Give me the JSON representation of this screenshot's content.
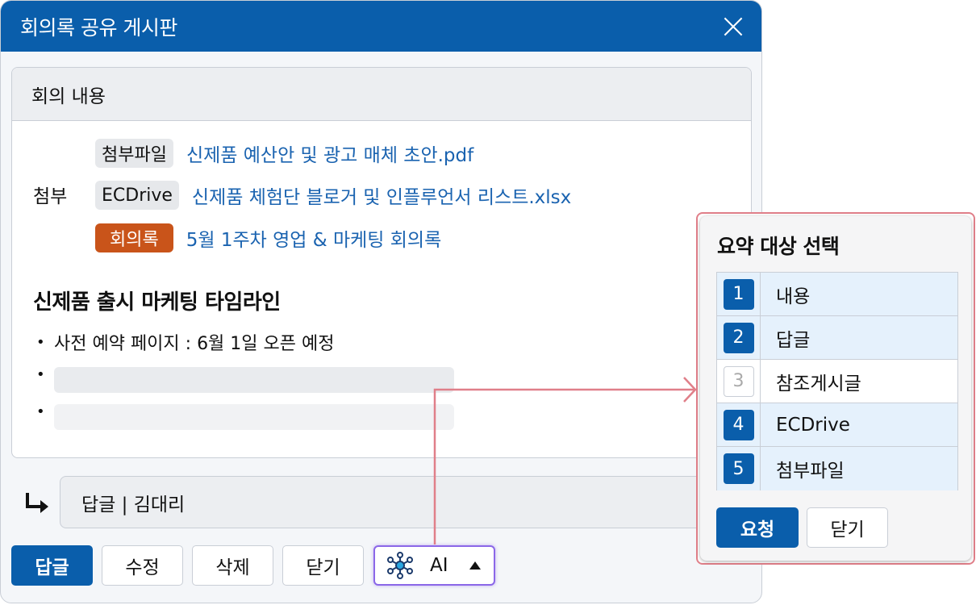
{
  "window": {
    "title": "회의록 공유 게시판"
  },
  "content": {
    "header": "회의 내용",
    "attach_label": "첨부",
    "attachments": [
      {
        "tag": "첨부파일",
        "file": "신제품 예산안 및 광고 매체 초안.pdf"
      },
      {
        "tag": "ECDrive",
        "file": "신제품 체험단 블로거 및 인플루언서 리스트.xlsx"
      },
      {
        "tag": "회의록",
        "file": "5월 1주차 영업 & 마케팅 회의록"
      }
    ],
    "section_title": "신제품 출시 마케팅 타임라인",
    "bullet": "•",
    "bullet_text": "사전 예약 페이지 : 6월 1일 오픈 예정"
  },
  "reply": {
    "text": "답글 | 김대리"
  },
  "buttons": {
    "reply": "답글",
    "edit": "수정",
    "delete": "삭제",
    "close": "닫기",
    "ai": "AI"
  },
  "popup": {
    "title": "요약 대상 선택",
    "options": [
      {
        "num": "1",
        "label": "내용",
        "selected": true
      },
      {
        "num": "2",
        "label": "답글",
        "selected": true
      },
      {
        "num": "3",
        "label": "참조게시글",
        "selected": false
      },
      {
        "num": "4",
        "label": "ECDrive",
        "selected": true
      },
      {
        "num": "5",
        "label": "첨부파일",
        "selected": true
      }
    ],
    "request": "요청",
    "close": "닫기"
  },
  "colors": {
    "brand": "#0a5eab",
    "link": "#1a63b0",
    "meeting_tag": "#c9541a",
    "ai_border": "#8b67e8",
    "connector": "#e07f89"
  },
  "icons": {
    "close": "close-icon",
    "reply_arrow": "reply-arrow-icon",
    "ai": "network-icon",
    "caret": "caret-up-icon"
  }
}
